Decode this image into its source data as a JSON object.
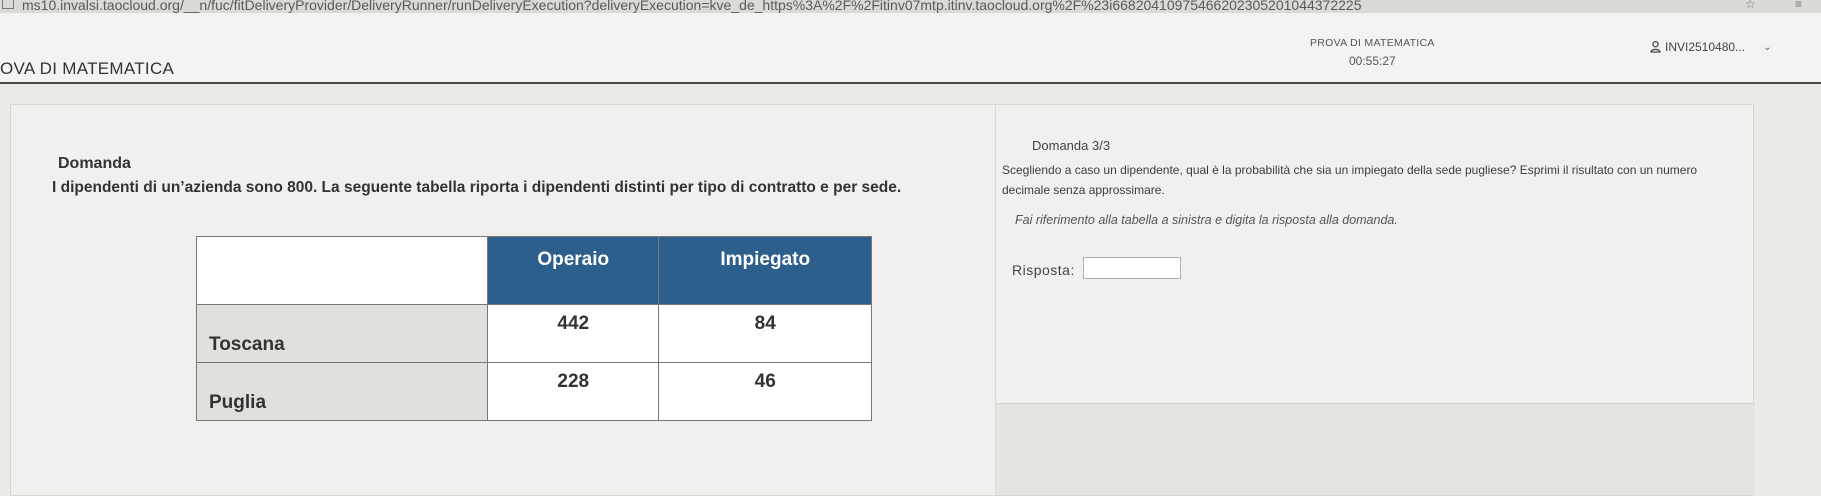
{
  "browser": {
    "url": "ms10.invalsi.taocloud.org/__n/fuc/fitDeliveryProvider/DeliveryRunner/runDeliveryExecution?deliveryExecution=kve_de_https%3A%2F%2Fitinv07mtp.itinv.taocloud.org%2F%23i66820410975466202305201044372225"
  },
  "header": {
    "app_title": "OVA DI MATEMATICA",
    "test_name": "PROVA DI MATEMATICA",
    "timer": "00:55:27",
    "user_id": "INVI2510480..."
  },
  "item": {
    "left_label": "Domanda",
    "stem": "I dipendenti di un’azienda sono 800. La seguente tabella riporta i dipendenti distinti per tipo di contratto e per sede.",
    "table": {
      "columns": [
        "Operaio",
        "Impiegato"
      ],
      "rows": [
        {
          "label": "Toscana",
          "values": [
            "442",
            "84"
          ]
        },
        {
          "label": "Puglia",
          "values": [
            "228",
            "46"
          ]
        }
      ]
    }
  },
  "question": {
    "label": "Domanda 3/3",
    "text": "Scegliendo a caso un dipendente, qual è la probabilità che sia un impiegato della sede pugliese? Esprimi il risultato con un numero decimale senza approssimare.",
    "hint": "Fai riferimento alla tabella a sinistra e digita la risposta alla domanda.",
    "answer_label": "Risposta:",
    "answer_value": ""
  },
  "icons": {
    "user": "user-icon",
    "chevron": "chevron-down-icon"
  },
  "colors": {
    "table_header": "#2d5f8c",
    "page_bg": "#eceae6"
  }
}
